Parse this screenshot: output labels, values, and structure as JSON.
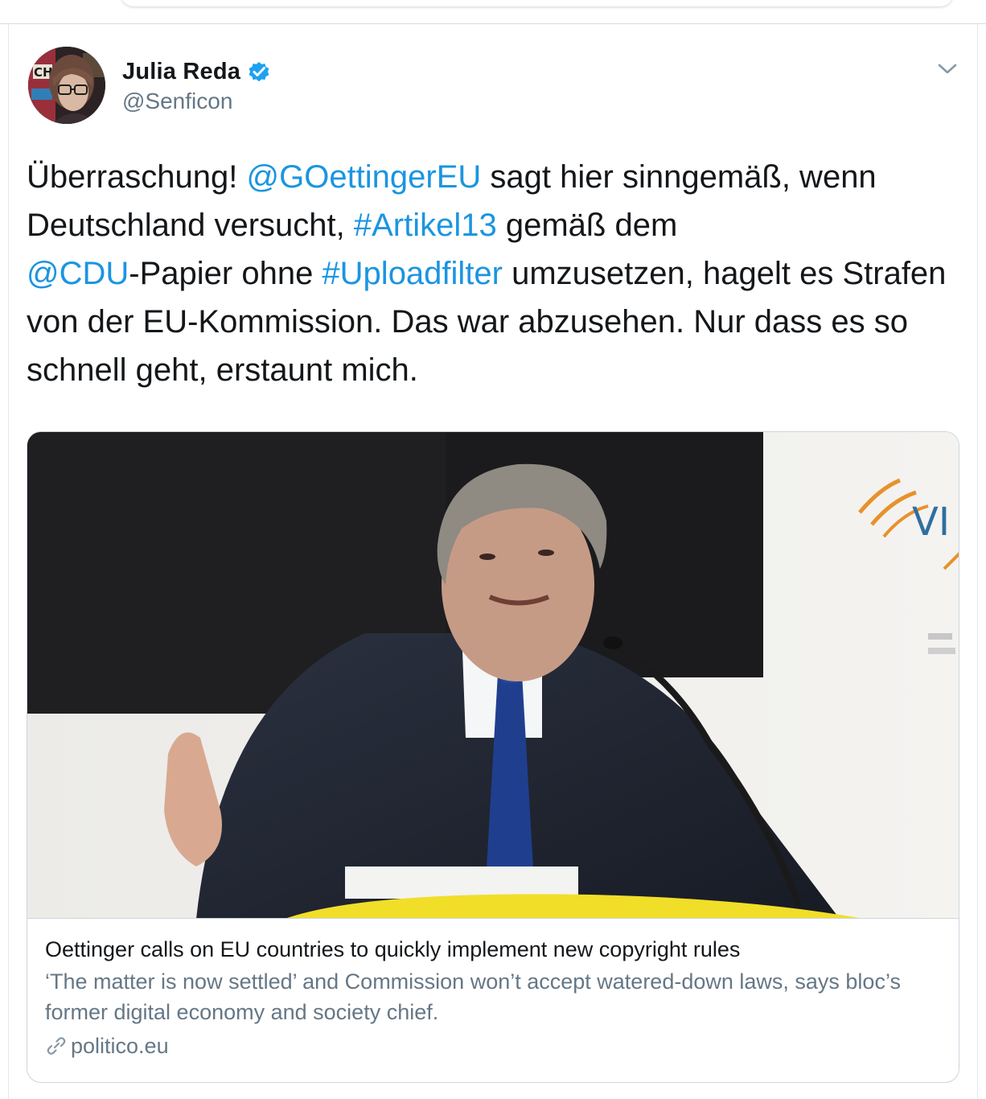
{
  "tweet": {
    "author": {
      "display_name": "Julia Reda",
      "handle": "@Senficon",
      "verified": true
    },
    "text_segments": [
      {
        "text": "Überraschung! ",
        "type": "plain"
      },
      {
        "text": "@GOettingerEU",
        "type": "link"
      },
      {
        "text": " sagt hier sinngemäß, wenn Deutschland versucht, ",
        "type": "plain"
      },
      {
        "text": "#Artikel13",
        "type": "link"
      },
      {
        "text": " gemäß dem ",
        "type": "plain"
      },
      {
        "text": "@CDU",
        "type": "link"
      },
      {
        "text": "-Papier ohne ",
        "type": "plain"
      },
      {
        "text": "#Uploadfilter",
        "type": "link"
      },
      {
        "text": " umzusetzen, hagelt es Strafen von der EU-Kommission. Das war abzusehen. Nur dass es so schnell geht, erstaunt mich.",
        "type": "plain"
      }
    ],
    "card": {
      "title": "Oettinger calls on EU countries to quickly implement new copyright rules",
      "description": "‘The matter is now settled’ and Commission won’t accept watered-down laws, says bloc’s former digital economy and society chief.",
      "domain": "politico.eu",
      "image_logo_fragment": "VI"
    }
  },
  "icons": {
    "verified": "verified-badge-icon",
    "caret": "chevron-down-icon",
    "link": "link-icon"
  },
  "colors": {
    "link": "#1b95e0",
    "text": "#14171a",
    "secondary": "#657786",
    "border": "#ccd6dd"
  }
}
